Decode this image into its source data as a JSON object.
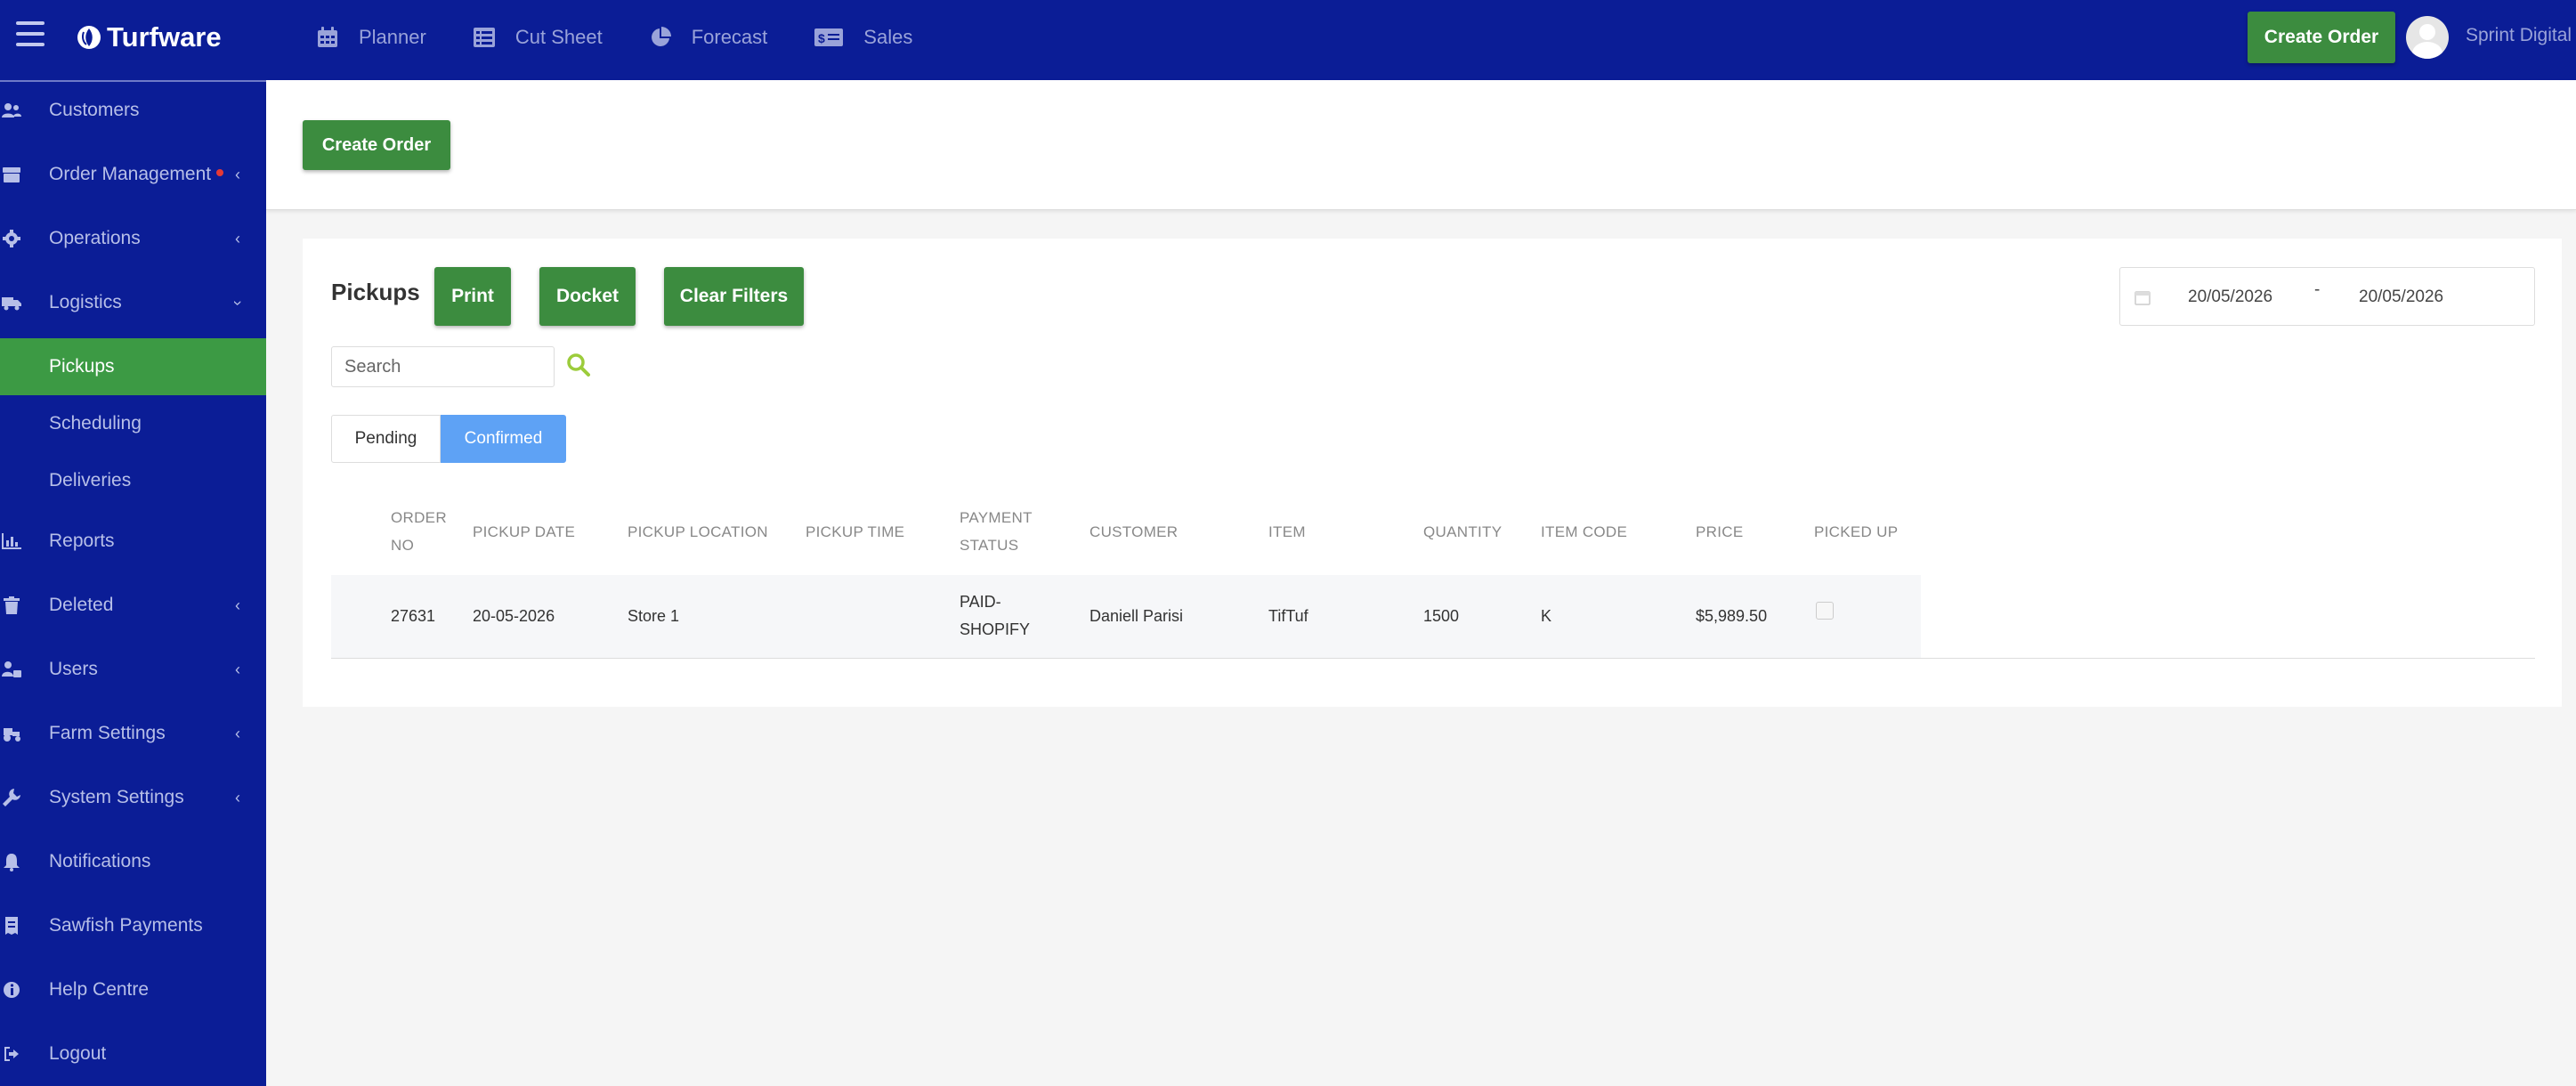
{
  "brand": {
    "name": "Turfware"
  },
  "topnav": [
    {
      "label": "Planner",
      "icon": "calendar-icon"
    },
    {
      "label": "Cut Sheet",
      "icon": "list-icon"
    },
    {
      "label": "Forecast",
      "icon": "pie-chart-icon"
    },
    {
      "label": "Sales",
      "icon": "money-icon"
    }
  ],
  "header": {
    "create_order_label": "Create Order",
    "user_name": "Sprint Digital"
  },
  "sidebar": {
    "items": [
      {
        "label": "Customers",
        "icon": "users-icon"
      },
      {
        "label": "Order Management",
        "icon": "box-icon",
        "has_dot": true,
        "chevron": "‹"
      },
      {
        "label": "Operations",
        "icon": "gear-icon",
        "chevron": "‹"
      },
      {
        "label": "Logistics",
        "icon": "truck-icon",
        "chevron": "›"
      },
      {
        "label": "Pickups",
        "active": true
      },
      {
        "label": "Scheduling"
      },
      {
        "label": "Deliveries"
      },
      {
        "label": "Reports",
        "icon": "bar-chart-icon"
      },
      {
        "label": "Deleted",
        "icon": "trash-icon",
        "chevron": "‹"
      },
      {
        "label": "Users",
        "icon": "user-lock-icon",
        "chevron": "‹"
      },
      {
        "label": "Farm Settings",
        "icon": "tractor-icon",
        "chevron": "‹"
      },
      {
        "label": "System Settings",
        "icon": "wrench-icon",
        "chevron": "‹"
      },
      {
        "label": "Notifications",
        "icon": "bell-icon"
      },
      {
        "label": "Sawfish Payments",
        "icon": "receipt-icon"
      },
      {
        "label": "Help Centre",
        "icon": "info-icon"
      },
      {
        "label": "Logout",
        "icon": "logout-icon"
      }
    ]
  },
  "page": {
    "create_order_label": "Create Order",
    "title": "Pickups",
    "print_label": "Print",
    "docket_label": "Docket",
    "clear_filters_label": "Clear Filters",
    "date_from": "20/05/2026",
    "date_sep": "-",
    "date_to": "20/05/2026",
    "search_placeholder": "Search",
    "tabs": {
      "pending": "Pending",
      "confirmed": "Confirmed",
      "active": "confirmed"
    }
  },
  "table": {
    "headers": {
      "order_no_1": "ORDER",
      "order_no_2": "NO",
      "pickup_date": "PICKUP DATE",
      "pickup_location": "PICKUP LOCATION",
      "pickup_time": "PICKUP TIME",
      "payment_status_1": "PAYMENT",
      "payment_status_2": "STATUS",
      "customer": "CUSTOMER",
      "item": "ITEM",
      "quantity": "QUANTITY",
      "item_code": "ITEM CODE",
      "price": "PRICE",
      "picked_up": "PICKED UP"
    },
    "rows": [
      {
        "order_no": "27631",
        "pickup_date": "20-05-2026",
        "pickup_location": "Store 1",
        "pickup_time": "",
        "payment_status_1": "PAID-",
        "payment_status_2": "SHOPIFY",
        "customer": "Daniell Parisi",
        "item": "TifTuf",
        "quantity": "1500",
        "item_code": "K",
        "price": "$5,989.50",
        "picked_up": false
      }
    ]
  },
  "colors": {
    "nav_bg": "#0b1d96",
    "green": "#3c8c3f",
    "active_green": "#3c9a44",
    "tab_blue": "#5ea2f5"
  }
}
